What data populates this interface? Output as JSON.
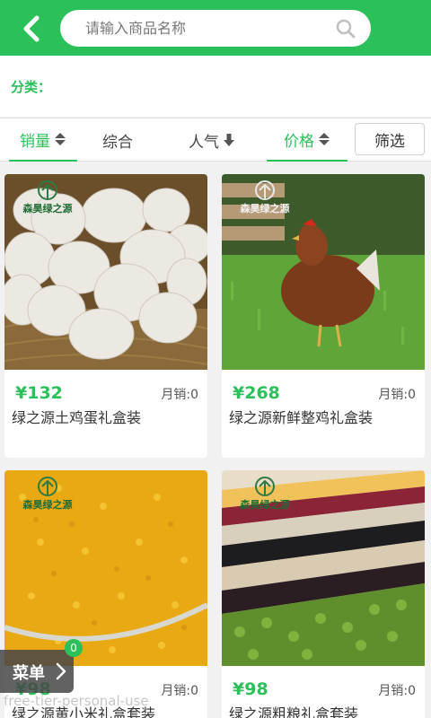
{
  "header": {
    "back_icon": "chevron-left-icon",
    "search_placeholder": "请输入商品名称",
    "search_value": "",
    "search_icon": "search-icon",
    "accent_color": "#2bc05a"
  },
  "category": {
    "label": "分类："
  },
  "sort": {
    "items": [
      {
        "label": "销量",
        "icon": "sort-updown-icon",
        "active": true
      },
      {
        "label": "综合",
        "icon": "",
        "active": false
      },
      {
        "label": "人气",
        "icon": "arrow-down-icon",
        "active": false
      },
      {
        "label": "价格",
        "icon": "sort-updown-icon",
        "active": true
      }
    ],
    "filter_label": "筛选"
  },
  "products": [
    {
      "price": "¥132",
      "sales": "月销:0",
      "name": "绿之源土鸡蛋礼盒装",
      "brand": "森昊绿之源",
      "image": "eggs"
    },
    {
      "price": "¥268",
      "sales": "月销:0",
      "name": "绿之源新鲜整鸡礼盒装",
      "brand": "森昊绿之源",
      "image": "chicken"
    },
    {
      "price": "¥98",
      "sales": "月销:0",
      "name": "绿之源黄小米礼盒套装",
      "brand": "森昊绿之源",
      "image": "millet"
    },
    {
      "price": "¥98",
      "sales": "月销:0",
      "name": "绿之源粗粮礼盒套装",
      "brand": "森昊绿之源",
      "image": "grains"
    }
  ],
  "menu": {
    "label": "菜单",
    "badge": "0",
    "icon": "chevron-right-icon"
  },
  "watermark": "free-tier-personal-use"
}
